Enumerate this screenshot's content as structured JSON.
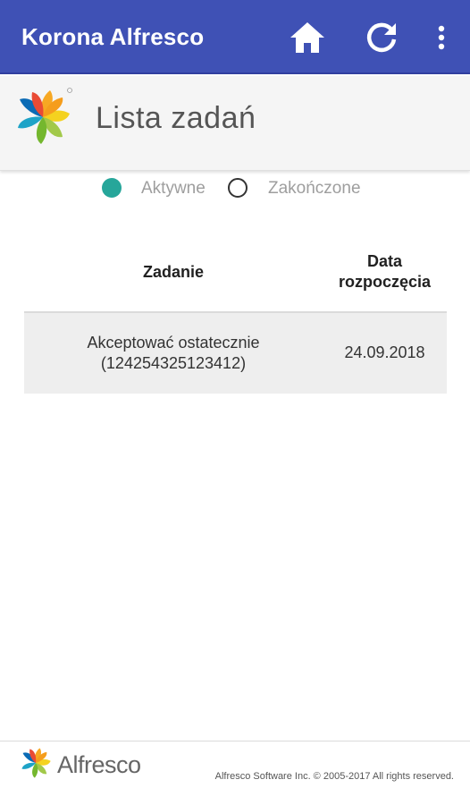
{
  "appbar": {
    "title": "Korona Alfresco",
    "icons": [
      "home-icon",
      "refresh-icon",
      "more-vert-icon"
    ],
    "color": "#3f51b5"
  },
  "header": {
    "logo": "alfresco-flower-logo",
    "title": "Lista zadań"
  },
  "filters": {
    "options": [
      {
        "label": "Aktywne",
        "selected": true
      },
      {
        "label": "Zakończone",
        "selected": false
      }
    ],
    "accent": "#26a69a"
  },
  "table": {
    "columns": [
      "Zadanie",
      "Data\nrozpoczęcia"
    ],
    "column_task": "Zadanie",
    "column_date_line1": "Data",
    "column_date_line2": "rozpoczęcia",
    "rows": [
      {
        "task_line1": "Akceptować ostatecznie",
        "task_line2": "(124254325123412)",
        "date": "24.09.2018"
      }
    ]
  },
  "footer": {
    "brand": "Alfresco",
    "copyright": "Alfresco Software Inc. © 2005-2017 All rights reserved."
  }
}
